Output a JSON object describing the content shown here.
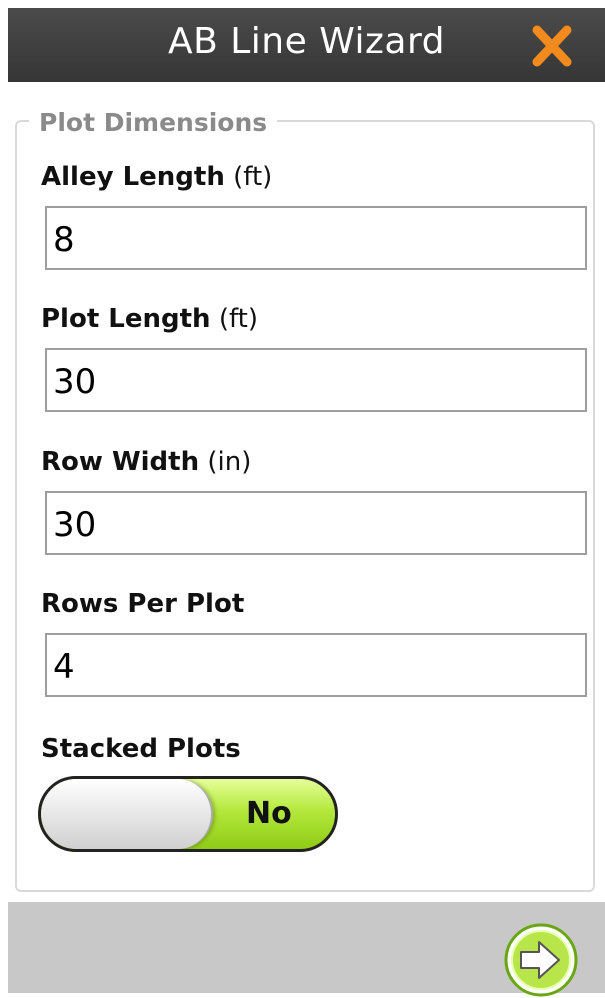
{
  "window": {
    "title": "AB Line Wizard"
  },
  "icons": {
    "close": "close-icon",
    "next": "arrow-right-icon"
  },
  "colors": {
    "titlebar": "#3c3c3c",
    "close_accent": "#f28a1e",
    "toggle_on": "#a6e22e",
    "next_button": "#b8e64a"
  },
  "group": {
    "legend": "Plot Dimensions"
  },
  "fields": [
    {
      "label": "Alley Length",
      "unit": "(ft)",
      "value": "8"
    },
    {
      "label": "Plot Length",
      "unit": "(ft)",
      "value": "30"
    },
    {
      "label": "Row Width",
      "unit": "(in)",
      "value": "30"
    },
    {
      "label": "Rows Per Plot",
      "unit": "",
      "value": "4"
    }
  ],
  "stacked": {
    "label": "Stacked Plots",
    "value": "No"
  }
}
